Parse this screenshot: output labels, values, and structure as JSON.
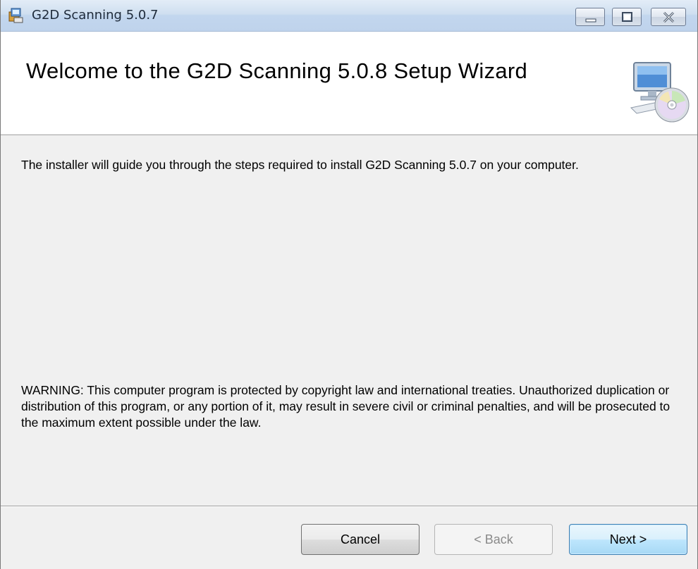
{
  "window": {
    "title": "G2D Scanning 5.0.7"
  },
  "banner": {
    "title": "Welcome to the G2D Scanning 5.0.8 Setup Wizard",
    "icon": "computer-cd-icon"
  },
  "body": {
    "intro": "The installer will guide you through the steps required to install G2D Scanning 5.0.7 on your computer.",
    "warning": "WARNING: This computer program is protected by copyright law and international treaties. Unauthorized duplication or distribution of this program, or any portion of it, may result in severe civil or criminal penalties, and will be prosecuted to the maximum extent possible under the law."
  },
  "buttons": {
    "cancel": "Cancel",
    "back": "< Back",
    "next": "Next >"
  },
  "colors": {
    "titlebar": "#c2d6ee",
    "dialog_bg": "#f0f0f0",
    "next_button": "#bee6fd"
  }
}
